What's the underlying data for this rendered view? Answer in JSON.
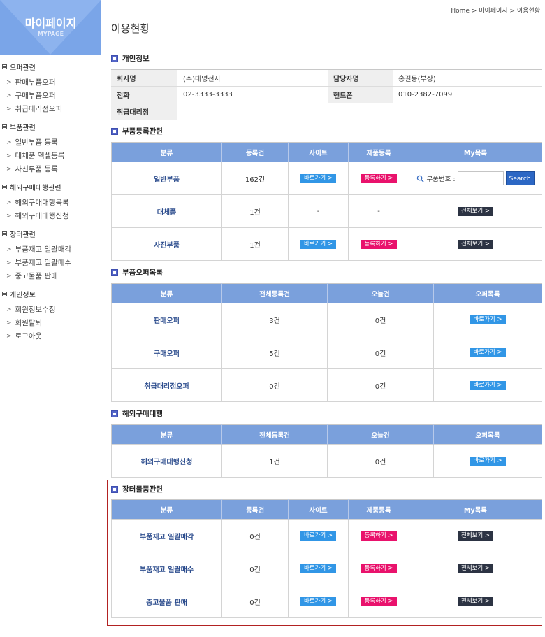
{
  "sidebar": {
    "title": "마이페이지",
    "subtitle": "MYPAGE",
    "groups": [
      {
        "label": "오퍼관련",
        "items": [
          "판매부품오퍼",
          "구매부품오퍼",
          "취급대리점오퍼"
        ]
      },
      {
        "label": "부품관련",
        "items": [
          "일반부품 등록",
          "대체품 엑셀등록",
          "사진부품 등록"
        ]
      },
      {
        "label": "해외구매대행관련",
        "items": [
          "해외구매대행목록",
          "해외구매대행신청"
        ]
      },
      {
        "label": "장터관련",
        "items": [
          "부품재고 일괄매각",
          "부품재고 일괄매수",
          "중고물품 판매"
        ]
      },
      {
        "label": "개인정보",
        "items": [
          "회원정보수정",
          "회원탈퇴",
          "로그아웃"
        ]
      }
    ]
  },
  "breadcrumb": "Home > 마이페이지 > 이용현황",
  "page_title": "이용현황",
  "personal": {
    "title": "개인정보",
    "company_label": "회사명",
    "company": "(주)대명전자",
    "manager_label": "담당자명",
    "manager": "홍길동(부장)",
    "phone_label": "전화",
    "phone": "02-3333-3333",
    "mobile_label": "핸드폰",
    "mobile": "010-2382-7099",
    "agency_label": "취급대리점",
    "agency": ""
  },
  "buttons": {
    "go": "바로가기 >",
    "register": "등록하기 >",
    "view_all": "전체보기 >",
    "search": "Search"
  },
  "part_reg": {
    "title": "부품등록관련",
    "headers": [
      "분류",
      "등록건",
      "사이트",
      "제품등록",
      "My목록"
    ],
    "search_label": "부품번호 :",
    "rows": [
      {
        "cat": "일반부품",
        "count": "162건",
        "site": "-",
        "reg": "-"
      },
      {
        "cat": "대체품",
        "count": "1건",
        "site": "-",
        "reg": "-"
      },
      {
        "cat": "사진부품",
        "count": "1건",
        "site": "-",
        "reg": "-"
      }
    ]
  },
  "offer": {
    "title": "부품오퍼목록",
    "headers": [
      "분류",
      "전체등록건",
      "오늘건",
      "오퍼목록"
    ],
    "rows": [
      {
        "cat": "판매오퍼",
        "total": "3건",
        "today": "0건"
      },
      {
        "cat": "구매오퍼",
        "total": "5건",
        "today": "0건"
      },
      {
        "cat": "취급대리점오퍼",
        "total": "0건",
        "today": "0건"
      }
    ]
  },
  "overseas": {
    "title": "해외구매대행",
    "headers": [
      "분류",
      "전체등록건",
      "오늘건",
      "오퍼목록"
    ],
    "rows": [
      {
        "cat": "해외구매대행신청",
        "total": "1건",
        "today": "0건"
      }
    ]
  },
  "market": {
    "title": "장터물품관련",
    "headers": [
      "분류",
      "등록건",
      "사이트",
      "제품등록",
      "My목록"
    ],
    "rows": [
      {
        "cat": "부품재고 일괄매각",
        "count": "0건"
      },
      {
        "cat": "부품재고 일괄매수",
        "count": "0건"
      },
      {
        "cat": "중고물품 판매",
        "count": "0건"
      }
    ]
  },
  "colors": {
    "header_blue": "#7aa0dc",
    "btn_blue": "#3196e6",
    "btn_pink": "#e9126c",
    "btn_navy": "#2c3343",
    "highlight_red": "#b22222"
  }
}
